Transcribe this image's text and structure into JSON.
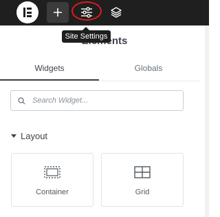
{
  "topbar": {
    "logo_icon": "elementor-logo-icon",
    "add_icon": "plus-icon",
    "settings_icon": "sliders-icon",
    "structure_icon": "layers-icon",
    "highlight_color": "#e01b1b"
  },
  "tooltip": {
    "text": "Site Settings"
  },
  "panel": {
    "title": "Elements"
  },
  "tabs": [
    {
      "label": "Widgets",
      "active": true
    },
    {
      "label": "Globals",
      "active": false
    }
  ],
  "search": {
    "placeholder": "Search Widget...",
    "icon": "search-icon"
  },
  "section": {
    "label": "Layout",
    "icon": "caret-down-icon"
  },
  "widgets": [
    {
      "label": "Container",
      "icon": "container-icon"
    },
    {
      "label": "Grid",
      "icon": "grid-icon"
    }
  ]
}
